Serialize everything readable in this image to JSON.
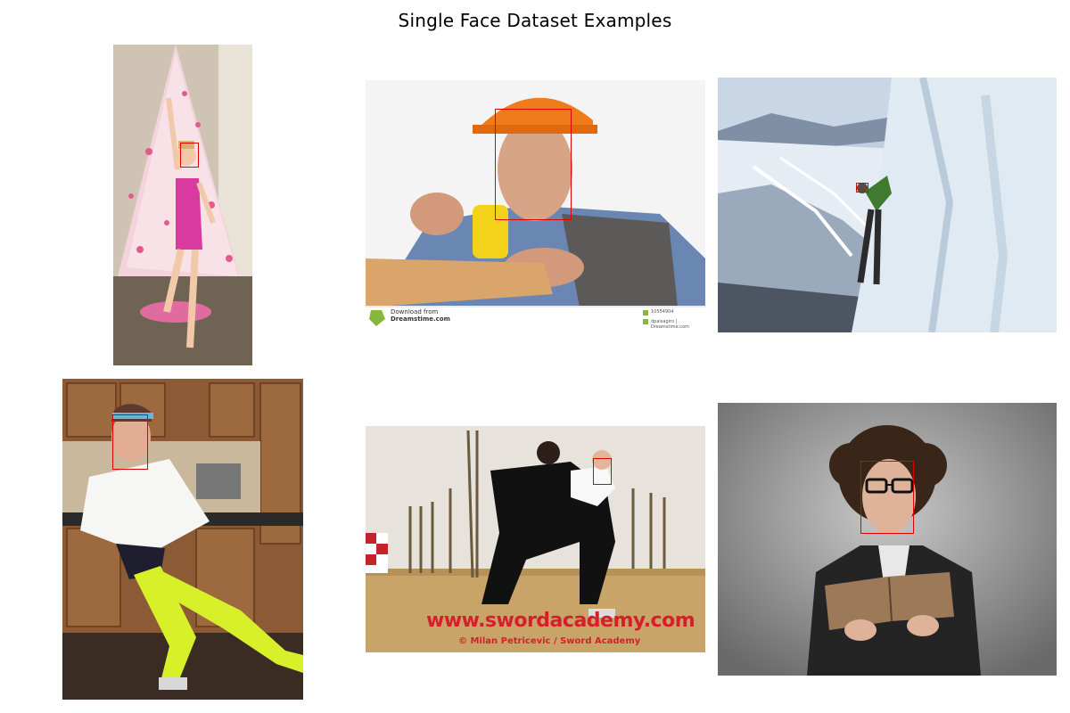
{
  "figure": {
    "title": "Single Face Dataset Examples"
  },
  "images": [
    {
      "scene": "girl gymnast in front of pink christmas tree",
      "watermark": ""
    },
    {
      "scene": "construction worker with orange hard hat and tape measure",
      "watermark_top": "Download from",
      "watermark_brand": "Dreamstime.com",
      "watermark_id": "10554904",
      "watermark_credit": "dpaisagiro | Dreamstime.com"
    },
    {
      "scene": "ice climber on frozen waterfall above snowy valley",
      "watermark": ""
    },
    {
      "scene": "woman in white sweater and neon leggings in kitchen",
      "watermark": ""
    },
    {
      "scene": "two people wrestling in sword academy",
      "watermark": "www.swordacademy.com",
      "watermark_credit": "© Milan Petricevic / Sword Academy"
    },
    {
      "scene": "curly haired man with glasses reading a book",
      "watermark": ""
    }
  ],
  "colors": {
    "box": "#e00000",
    "background": "#ffffff"
  }
}
